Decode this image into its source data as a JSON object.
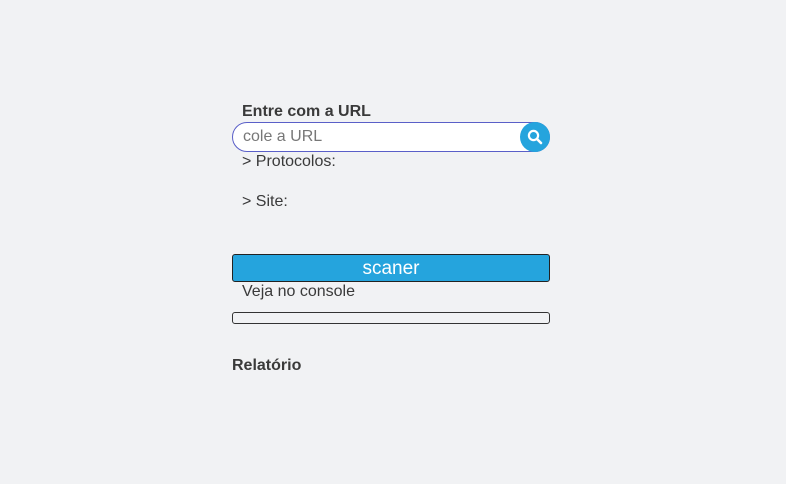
{
  "form": {
    "url_label": "Entre com a URL",
    "url_placeholder": "cole a URL",
    "url_value": "",
    "search_icon": "search-icon",
    "protocols_label": "> Protocolos:",
    "site_label": "> Site:",
    "scan_button": "scaner",
    "console_note": "Veja no console",
    "progress": 0
  },
  "report": {
    "title": "Relatório"
  },
  "colors": {
    "background": "#f1f2f4",
    "accent": "#25a4dd",
    "input_border": "#5a5fc8",
    "text": "#3a3a3a"
  }
}
